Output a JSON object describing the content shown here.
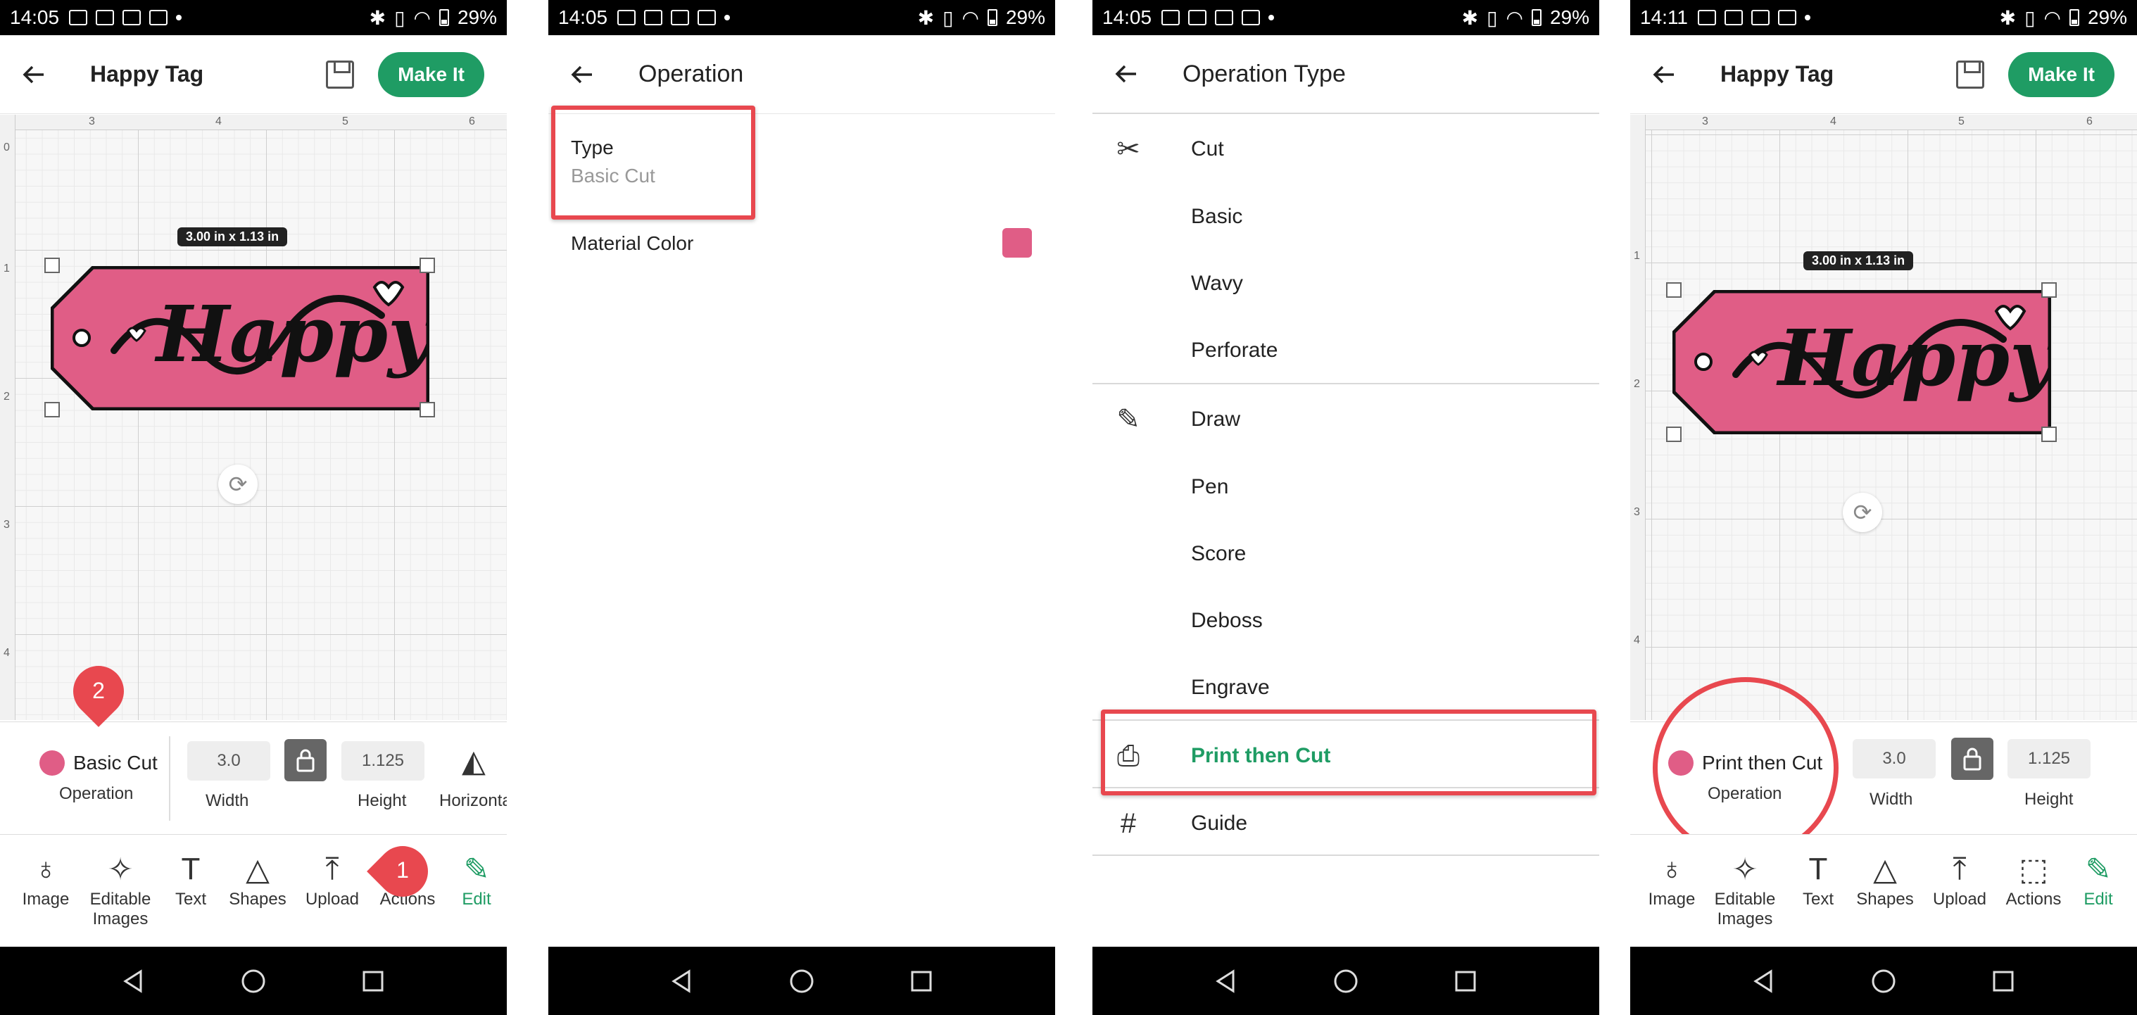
{
  "status": {
    "time1": "14:05",
    "time2": "14:05",
    "time3": "14:05",
    "time4": "14:11",
    "battery": "29%"
  },
  "screen1": {
    "title": "Happy Tag",
    "make_it": "Make It",
    "dimension": "3.00 in x 1.13 in",
    "ruler_top": [
      "3",
      "4",
      "5",
      "6"
    ],
    "ruler_left": [
      "0",
      "1",
      "2",
      "3",
      "4"
    ],
    "tag_text": "Happy",
    "operation_value": "Basic Cut",
    "operation_caption": "Operation",
    "width_value": "3.0",
    "width_caption": "Width",
    "height_value": "1.125",
    "height_caption": "Height",
    "flip_caption": "Horizonta",
    "tools": [
      "Image",
      "Editable Images",
      "Text",
      "Shapes",
      "Upload",
      "Actions",
      "Edit"
    ],
    "pin1": "1",
    "pin2": "2"
  },
  "screen2": {
    "title": "Operation",
    "type_label": "Type",
    "type_value": "Basic Cut",
    "material_label": "Material Color"
  },
  "screen3": {
    "title": "Operation Type",
    "items": [
      "Cut",
      "Basic",
      "Wavy",
      "Perforate",
      "Draw",
      "Pen",
      "Score",
      "Deboss",
      "Engrave",
      "Print then Cut",
      "Guide"
    ]
  },
  "screen4": {
    "title": "Happy Tag",
    "make_it": "Make It",
    "dimension": "3.00 in x 1.13 in",
    "ruler_top": [
      "3",
      "4",
      "5",
      "6"
    ],
    "ruler_left": [
      "1",
      "2",
      "3",
      "4"
    ],
    "tag_text": "Happy",
    "operation_value": "Print then Cut",
    "operation_caption": "Operation",
    "width_value": "3.0",
    "width_caption": "Width",
    "height_value": "1.125",
    "height_caption": "Height",
    "tools": [
      "Image",
      "Editable Images",
      "Text",
      "Shapes",
      "Upload",
      "Actions",
      "Edit"
    ]
  },
  "colors": {
    "accent_green": "#1f9c64",
    "tag_pink": "#e05d86",
    "annotation_red": "#e8484f"
  }
}
